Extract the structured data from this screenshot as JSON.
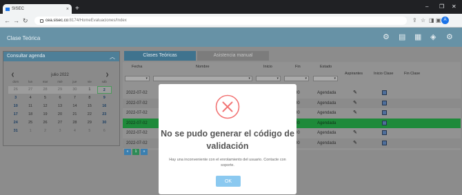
{
  "browser": {
    "tab_title": "SISEC",
    "tab_close": "×",
    "new_tab": "+",
    "url_host": "cea.sisec.co",
    "url_path": ":8174/HomeEvaluaciones/Index",
    "profile_initial": "A",
    "window_controls": [
      "–",
      "❐",
      "✕"
    ],
    "nav": [
      "←",
      "→",
      "↻"
    ],
    "tools": [
      "⇪",
      "☆",
      "◨",
      "▣"
    ]
  },
  "app": {
    "title": "Clase Teórica",
    "header_icons": [
      "users-gear-icon",
      "book-icon",
      "calendar-icon",
      "shield-icon",
      "gear-icon"
    ]
  },
  "left_panel": {
    "title": "Consultar agenda",
    "chevron": "︿",
    "calendar": {
      "month": "julio 2022",
      "prev": "❮",
      "next": "❯",
      "days_of_week": [
        "dom",
        "lun",
        "mar",
        "mié",
        "jue",
        "vie",
        "sáb"
      ],
      "weeks": [
        [
          "26",
          "27",
          "28",
          "29",
          "30",
          "1",
          "2"
        ],
        [
          "3",
          "4",
          "5",
          "6",
          "7",
          "8",
          "9"
        ],
        [
          "10",
          "11",
          "12",
          "13",
          "14",
          "15",
          "16"
        ],
        [
          "17",
          "18",
          "19",
          "20",
          "21",
          "22",
          "23"
        ],
        [
          "24",
          "25",
          "26",
          "27",
          "28",
          "29",
          "30"
        ],
        [
          "31",
          "1",
          "2",
          "3",
          "4",
          "5",
          "6"
        ]
      ]
    }
  },
  "tabs": [
    {
      "label": "Clases Teóricas",
      "active": true
    },
    {
      "label": "Asistencia manual",
      "active": false
    }
  ],
  "table": {
    "headers": [
      "Fecha",
      "Nombre",
      "Inicio",
      "Fin",
      "Estado",
      "Aspirantes",
      "Inicio Clase",
      "Fin Clase"
    ],
    "rows": [
      {
        "fecha": "2022-07-02",
        "fin": "00",
        "estado": "Agendada",
        "edit": true
      },
      {
        "fecha": "2022-07-02",
        "fin": "00",
        "estado": "Agendada",
        "edit": true
      },
      {
        "fecha": "2022-07-02",
        "fin": "00",
        "estado": "Agendada",
        "edit": true
      },
      {
        "fecha": "2022-07-02",
        "fin": "00",
        "estado": "Agendada",
        "edit": false
      },
      {
        "fecha": "2022-07-02",
        "fin": "00",
        "estado": "Agendada",
        "edit": true
      },
      {
        "fecha": "2022-07-02",
        "fin": "00",
        "estado": "Agendada",
        "edit": true
      }
    ],
    "pagination": [
      "«",
      "1",
      "»"
    ],
    "filter_caret": "▾"
  },
  "modal": {
    "title": "No se pudo generar el código de validación",
    "message": "Hay una inconveniente con el enrolamiento del usuario. Contacte con soporte.",
    "ok_label": "OK"
  },
  "colors": {
    "header": "#6792a6",
    "overlay_bg": "#8c8c8c",
    "error_red": "#f27474",
    "ok_button": "#8bc9f0",
    "highlight_row": "#1e8a3a"
  }
}
